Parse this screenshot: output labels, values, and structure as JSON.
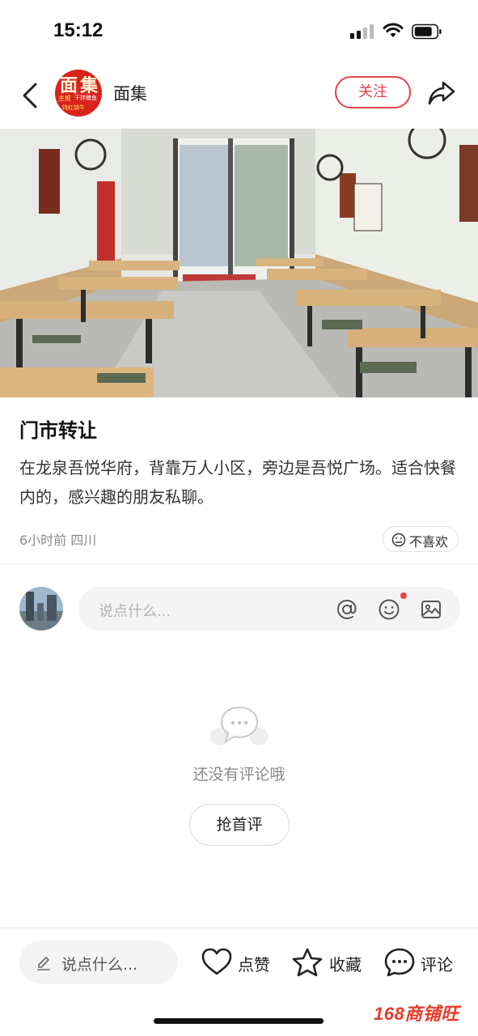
{
  "status_bar": {
    "time": "15:12"
  },
  "header": {
    "shop_name": "面集",
    "logo_big_1": "面",
    "logo_big_2": "集",
    "logo_small_1": "主推",
    "logo_small_2": "干拌鳝鱼",
    "logo_small_3": "特红烧牛",
    "follow_label": "关注"
  },
  "post": {
    "title": "门市转让",
    "body": "在龙泉吾悦华府，背靠万人小区，旁边是吾悦广场。适合快餐内的，感兴趣的朋友私聊。",
    "time_ago": "6小时前",
    "location": "四川",
    "dislike_label": "不喜欢"
  },
  "comment_box": {
    "placeholder": "说点什么..."
  },
  "empty_state": {
    "message": "还没有评论哦",
    "button_label": "抢首评"
  },
  "bottom_bar": {
    "placeholder": "说点什么...",
    "like_label": "点赞",
    "collect_label": "收藏",
    "comment_label": "评论"
  },
  "watermark": "168商铺旺",
  "colors": {
    "accent": "#e8434b",
    "logo_red": "#d8231c"
  }
}
